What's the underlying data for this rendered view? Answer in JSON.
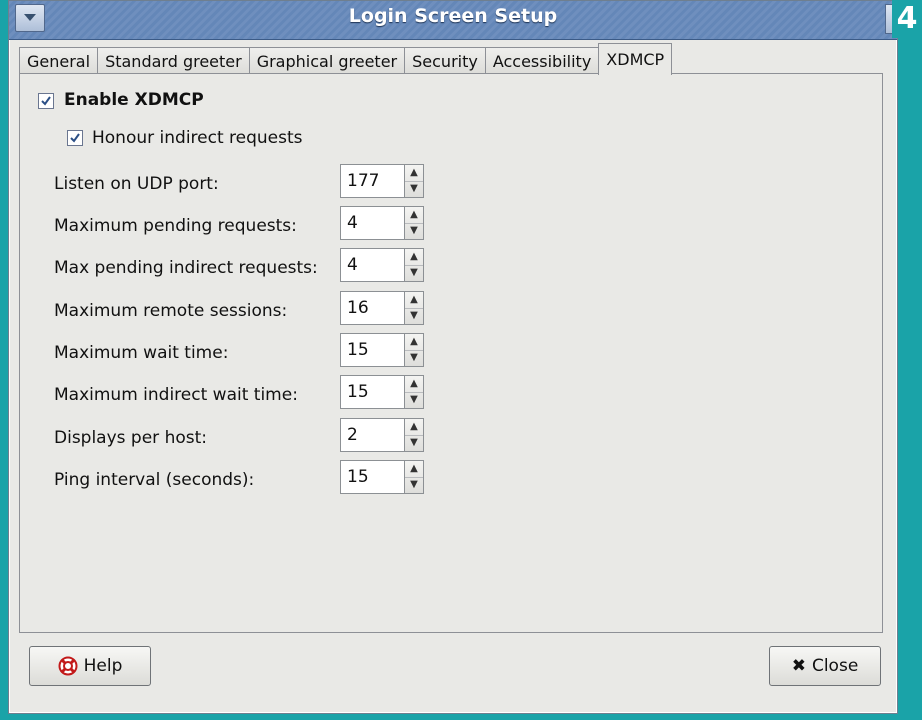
{
  "window": {
    "title": "Login Screen Setup",
    "badge": "4"
  },
  "tabs": [
    {
      "label": "General"
    },
    {
      "label": "Standard greeter"
    },
    {
      "label": "Graphical greeter"
    },
    {
      "label": "Security"
    },
    {
      "label": "Accessibility"
    },
    {
      "label": "XDMCP"
    }
  ],
  "xdmcp": {
    "enable_label": "Enable XDMCP",
    "enable_checked": true,
    "honour_label": "Honour indirect requests",
    "honour_checked": true,
    "fields": [
      {
        "label": "Listen on UDP port:",
        "value": "177"
      },
      {
        "label": "Maximum pending requests:",
        "value": "4"
      },
      {
        "label": "Max pending indirect requests:",
        "value": "4"
      },
      {
        "label": "Maximum remote sessions:",
        "value": "16"
      },
      {
        "label": "Maximum wait time:",
        "value": "15"
      },
      {
        "label": "Maximum indirect wait time:",
        "value": "15"
      },
      {
        "label": "Displays per host:",
        "value": "2"
      },
      {
        "label": "Ping interval (seconds):",
        "value": "15"
      }
    ]
  },
  "buttons": {
    "help_label": "Help",
    "close_label": "Close"
  },
  "icons": {
    "window_menu": "menu-arrow-icon",
    "help": "lifebuoy-icon",
    "close": "x-icon",
    "checkmark": "check-icon",
    "spin_up": "chevron-up-icon",
    "spin_down": "chevron-down-icon"
  },
  "colors": {
    "titlebar": "#6487b8",
    "background": "#1aa3a8",
    "dialog": "#e9e9e6"
  }
}
